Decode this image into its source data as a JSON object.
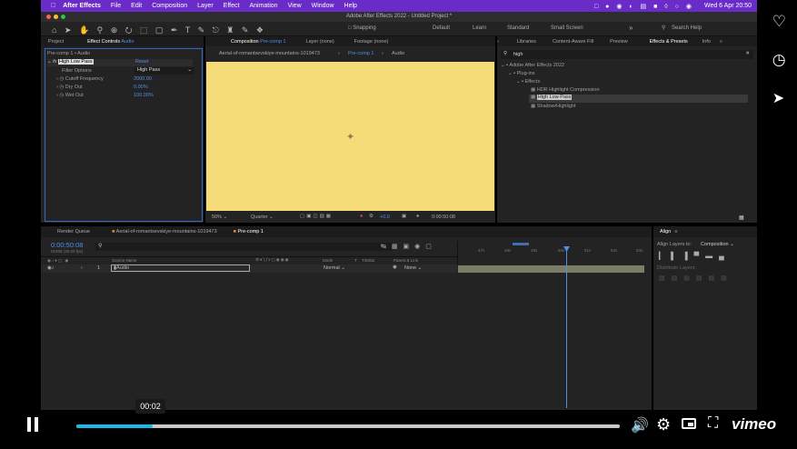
{
  "menubar": {
    "app": "After Effects",
    "items": [
      "File",
      "Edit",
      "Composition",
      "Layer",
      "Effect",
      "Animation",
      "View",
      "Window",
      "Help"
    ],
    "clock": "Wed 6 Apr  20:50"
  },
  "window_title": "Adobe After Effects 2022 - Untitled Project *",
  "toolbar": {
    "snapping": "Snapping",
    "workspaces": [
      "Default",
      "Learn",
      "Standard",
      "Small Screen"
    ],
    "search_placeholder": "Search Help"
  },
  "left_panel": {
    "tabs": {
      "project": "Project",
      "effect_controls": "Effect Controls",
      "effect_target": "Audio"
    },
    "breadcrumb": "Pre-comp 1 • Audio",
    "effect_name": "High Low Pass",
    "reset": "Reset",
    "filter_options_label": "Filter Options",
    "filter_options_value": "High Pass",
    "params": [
      {
        "name": "Cutoff Frequency",
        "value": "2000.00"
      },
      {
        "name": "Dry Out",
        "value": "0.00%"
      },
      {
        "name": "Wet Out",
        "value": "100.00%"
      }
    ]
  },
  "comp_panel": {
    "tabs": {
      "composition": "Composition",
      "comp_name": "Pre-comp 1",
      "layer": "Layer (none)",
      "footage": "Footage (none)"
    },
    "crumbs": [
      "Aerial-of-romantsevskiye-mountains-1019473",
      "Pre-comp 1",
      "Audio"
    ],
    "zoom": "50%",
    "resolution": "Quarter",
    "exposure": "+0.0",
    "timecode": "0:00:50:08",
    "bg_color": "#f5dc78"
  },
  "right_panel": {
    "tabs": [
      "Libraries",
      "Content-Aware Fill",
      "Preview",
      "Effects & Presets",
      "Info"
    ],
    "search_value": "high",
    "tree": [
      {
        "label": "Adobe After Effects 2022",
        "level": 0
      },
      {
        "label": "Plug-ins",
        "level": 1
      },
      {
        "label": "Effects",
        "level": 2
      },
      {
        "label": "HDR Highlight Compression",
        "level": 3
      },
      {
        "label": "High Low Pass",
        "level": 3,
        "selected": true
      },
      {
        "label": "Shadow/Highlight",
        "level": 3
      }
    ]
  },
  "timeline": {
    "tabs": [
      "Render Queue",
      "Aerial-of-romantsevskiye-mountains-1019473",
      "Pre-comp 1"
    ],
    "timecode": "0:00:50:08",
    "subcode": "01508 (30.00 fps)",
    "columns": [
      "Source Name",
      "Mode",
      "T",
      "TrkMat",
      "Parent & Link"
    ],
    "layers": [
      {
        "index": "1",
        "name": "Audio",
        "mode": "Normal",
        "parent": "None"
      }
    ],
    "ruler": [
      "47s",
      "48s",
      "49s",
      "50s",
      "51s",
      "52s",
      "53s"
    ]
  },
  "align_panel": {
    "title": "Align",
    "align_layers_to_label": "Align Layers to:",
    "align_layers_to_value": "Composition",
    "distribute_label": "Distribute Layers:"
  },
  "player": {
    "tooltip": "00:02",
    "progress": 0.14,
    "brand": "vimeo"
  }
}
